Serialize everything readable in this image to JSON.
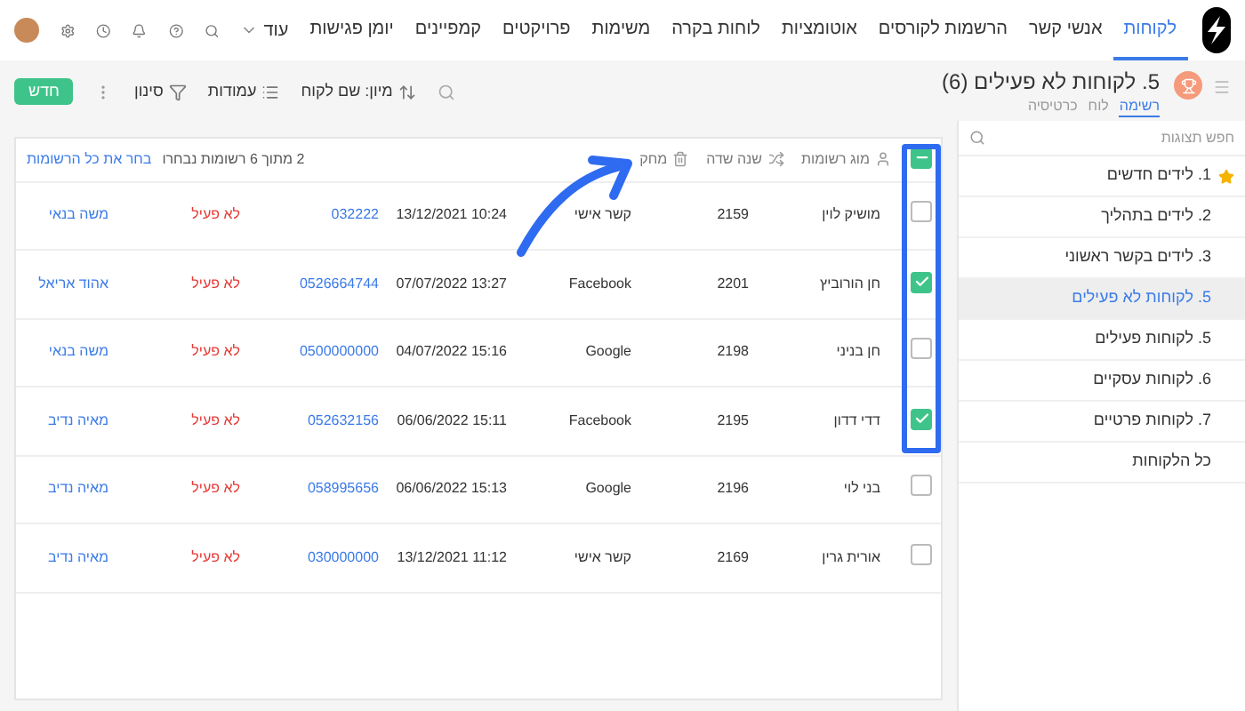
{
  "nav": {
    "items": [
      {
        "label": "לקוחות",
        "selected": true
      },
      {
        "label": "אנשי קשר",
        "selected": false
      },
      {
        "label": "הרשמות לקורסים",
        "selected": false
      },
      {
        "label": "אוטומציות",
        "selected": false
      },
      {
        "label": "לוחות בקרה",
        "selected": false
      },
      {
        "label": "משימות",
        "selected": false
      },
      {
        "label": "פרויקטים",
        "selected": false
      },
      {
        "label": "קמפיינים",
        "selected": false
      },
      {
        "label": "יומן פגישות",
        "selected": false
      }
    ],
    "more": "עוד"
  },
  "view": {
    "title": "5. לקוחות לא פעילים (6)",
    "tabs": [
      {
        "label": "רשימה",
        "selected": true
      },
      {
        "label": "לוח",
        "selected": false
      },
      {
        "label": "כרטיסיה",
        "selected": false
      }
    ]
  },
  "toolbar": {
    "sort": "מיון: שם לקוח",
    "columns": "עמודות",
    "filter": "סינון",
    "new": "חדש"
  },
  "table": {
    "select_all": {
      "indeterminate": true
    },
    "actions": [
      {
        "kind": "merge",
        "label": "מוג רשומות"
      },
      {
        "kind": "change",
        "label": "שנה שדה"
      },
      {
        "kind": "delete",
        "label": "מחק"
      }
    ],
    "selection_text": "2 מתוך 6 רשומות נבחרו",
    "select_all_link": "בחר את כל הרשומות",
    "rows": [
      {
        "checked": false,
        "name": "מושיק לוין",
        "id": "2159",
        "source": "קשר אישי",
        "date": "10:24 13/12/2021",
        "phone": "032222",
        "status": "לא פעיל",
        "owner": "משה בנאי"
      },
      {
        "checked": true,
        "name": "חן הורוביץ",
        "id": "2201",
        "source": "Facebook",
        "date": "13:27 07/07/2022",
        "phone": "0526664744",
        "status": "לא פעיל",
        "owner": "אהוד אריאל"
      },
      {
        "checked": false,
        "name": "חן בניני",
        "id": "2198",
        "source": "Google",
        "date": "15:16 04/07/2022",
        "phone": "0500000000",
        "status": "לא פעיל",
        "owner": "משה בנאי"
      },
      {
        "checked": true,
        "name": "דדי דדון",
        "id": "2195",
        "source": "Facebook",
        "date": "15:11 06/06/2022",
        "phone": "052632156",
        "status": "לא פעיל",
        "owner": "מאיה נדיב"
      },
      {
        "checked": false,
        "name": "בני לוי",
        "id": "2196",
        "source": "Google",
        "date": "15:13 06/06/2022",
        "phone": "058995656",
        "status": "לא פעיל",
        "owner": "מאיה נדיב"
      },
      {
        "checked": false,
        "name": "אורית גרין",
        "id": "2169",
        "source": "קשר אישי",
        "date": "11:12 13/12/2021",
        "phone": "030000000",
        "status": "לא פעיל",
        "owner": "מאיה נדיב"
      }
    ]
  },
  "sidebar": {
    "placeholder": "חפש תצוגות",
    "items": [
      {
        "label": "1. לידים חדשים",
        "selected": false,
        "starred": true
      },
      {
        "label": "2. לידים בתהליך",
        "selected": false,
        "starred": false
      },
      {
        "label": "3. לידים בקשר ראשוני",
        "selected": false,
        "starred": false
      },
      {
        "label": "5. לקוחות לא פעילים",
        "selected": true,
        "starred": false
      },
      {
        "label": "5. לקוחות פעילים",
        "selected": false,
        "starred": false
      },
      {
        "label": "6. לקוחות עסקיים",
        "selected": false,
        "starred": false
      },
      {
        "label": "7. לקוחות פרטיים",
        "selected": false,
        "starred": false
      },
      {
        "label": "כל הלקוחות",
        "selected": false,
        "starred": false
      }
    ]
  }
}
